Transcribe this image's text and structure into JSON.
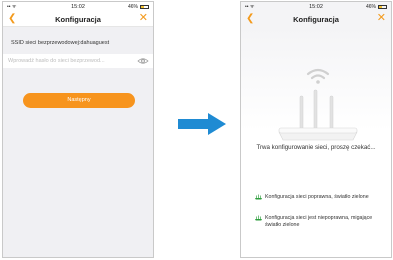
{
  "left_screen": {
    "status_bar": {
      "left": "•• ᯤ",
      "time": "15:02",
      "battery_text": "46%",
      "battery_level": 0.46
    },
    "nav": {
      "title": "Konfiguracja",
      "back_icon": "chevron-left-icon",
      "close_icon": "close-icon"
    },
    "ssid_label": "SSID sieci bezprzewodowej:dahuaguest",
    "password": {
      "value": "",
      "placeholder": "Wprowadź hasło do sieci bezprzewod..."
    },
    "next_button": "Następny"
  },
  "arrow": {
    "color": "#1f8bd3"
  },
  "right_screen": {
    "status_bar": {
      "left": "•• ᯤ",
      "time": "15:02",
      "battery_text": "46%",
      "battery_level": 0.46
    },
    "nav": {
      "title": "Konfiguracja",
      "back_icon": "chevron-left-icon",
      "close_icon": "close-icon"
    },
    "progress_text": "Trwa konfigurowanie sieci, proszę czekać...",
    "legend": [
      {
        "text": "Konfiguracja sieci poprawna, światło zielone",
        "icon": "router-green-icon"
      },
      {
        "text": "Konfiguracja sieci jest niepoprawna, migające światło zielone",
        "icon": "router-green-icon"
      }
    ]
  },
  "colors": {
    "accent": "#f7941d",
    "arrow": "#1f8bd3",
    "led_green": "#2e9e3e"
  }
}
